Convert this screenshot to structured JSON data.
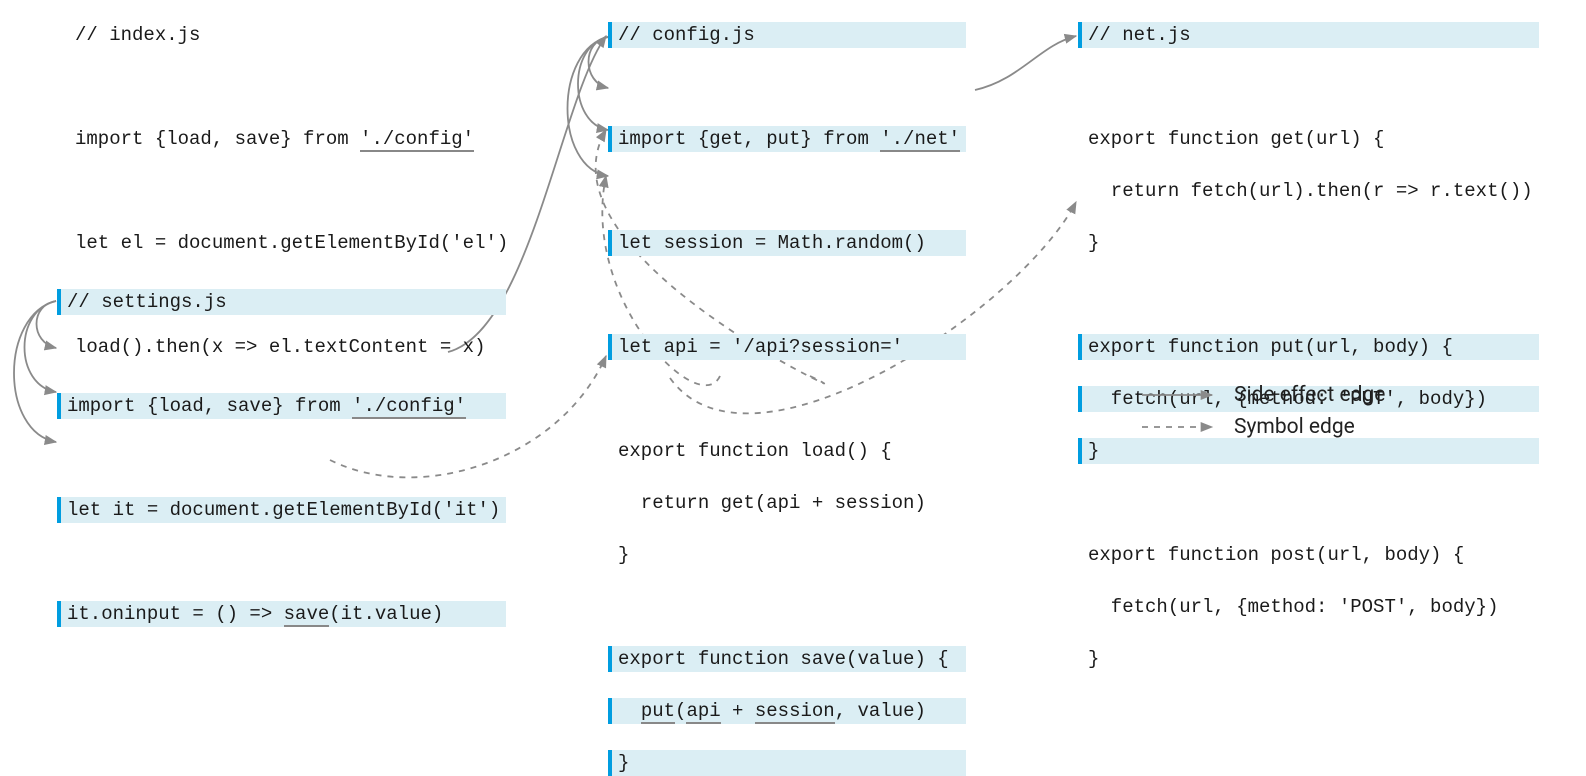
{
  "colors": {
    "highlight_bg": "#dbeef4",
    "highlight_bar": "#009de0",
    "arrow": "#8a8a8a"
  },
  "blocks": {
    "index": {
      "comment": "// index.js",
      "l1_pre": "import {load, save} from ",
      "l1_ul": "'./config'",
      "l2": "let el = document.getElementById('el')",
      "l3": "load().then(x => el.textContent = x)"
    },
    "settings": {
      "comment": "// settings.js",
      "l1_pre": "import {load, save} from ",
      "l1_ul": "'./config'",
      "l2": "let it = document.getElementById('it')",
      "l3_pre": "it.oninput = () => ",
      "l3_ul": "save",
      "l3_post": "(it.value)"
    },
    "config": {
      "comment": "// config.js",
      "l1_pre": "import {get, put} from ",
      "l1_ul": "'./net'",
      "l2": "let session = Math.random()",
      "l3": "let api = '/api?session='",
      "l4a": "export function load() {",
      "l4b": "  return get(api + session)",
      "l4c": "}",
      "l5a": "export function save(value) {",
      "l5b_pre": "  ",
      "l5b_ul": "put",
      "l5b_mid": "(",
      "l5b_ul2": "api",
      "l5b_mid2": " + ",
      "l5b_ul3": "session",
      "l5b_post": ", value)",
      "l5c": "}"
    },
    "net": {
      "comment": "// net.js",
      "l1a": "export function get(url) {",
      "l1b": "  return fetch(url).then(r => r.text())",
      "l1c": "}",
      "l2a": "export function put(url, body) {",
      "l2b": "  fetch(url, {method: 'PUT', body})",
      "l2c": "}",
      "l3a": "export function post(url, body) {",
      "l3b": "  fetch(url, {method: 'POST', body})",
      "l3c": "}"
    }
  },
  "legend": {
    "side_effect": "Side effect edge",
    "symbol": "Symbol edge"
  }
}
